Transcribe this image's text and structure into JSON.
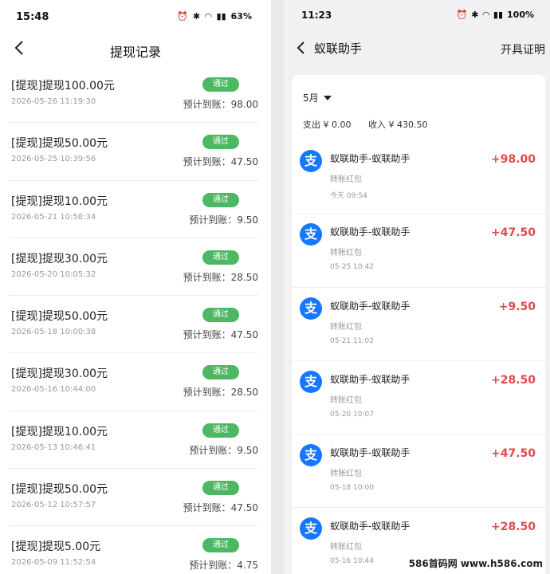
{
  "left": {
    "status": {
      "time": "15:48",
      "battery": "63%"
    },
    "nav": {
      "title": "提现记录"
    },
    "badge_label": "通过",
    "est_label": "预计到账：",
    "items": [
      {
        "title": "[提现]提现100.00元",
        "time": "2026-05-26 11:19:30",
        "est": "98.00"
      },
      {
        "title": "[提现]提现50.00元",
        "time": "2026-05-25 10:39:56",
        "est": "47.50"
      },
      {
        "title": "[提现]提现10.00元",
        "time": "2026-05-21 10:58:34",
        "est": "9.50"
      },
      {
        "title": "[提现]提现30.00元",
        "time": "2026-05-20 10:05:32",
        "est": "28.50"
      },
      {
        "title": "[提现]提现50.00元",
        "time": "2026-05-18 10:00:38",
        "est": "47.50"
      },
      {
        "title": "[提现]提现30.00元",
        "time": "2026-05-16 10:44:00",
        "est": "28.50"
      },
      {
        "title": "[提现]提现10.00元",
        "time": "2026-05-13 10:46:41",
        "est": "9.50"
      },
      {
        "title": "[提现]提现50.00元",
        "time": "2026-05-12 10:57:57",
        "est": "47.50"
      },
      {
        "title": "[提现]提现5.00元",
        "time": "2026-05-09 11:52:54",
        "est": "4.75"
      }
    ]
  },
  "right": {
    "status": {
      "time": "11:23",
      "battery": "100%"
    },
    "nav": {
      "title": "蚁联助手",
      "action": "开具证明"
    },
    "month": "5月",
    "summary": {
      "expense": "支出 ¥ 0.00",
      "income": "收入 ¥ 430.50"
    },
    "icon_glyph": "支",
    "items": [
      {
        "name": "蚁联助手-蚁联助手",
        "sub": "转账红包",
        "date": "今天 09:54",
        "amount": "+98.00"
      },
      {
        "name": "蚁联助手-蚁联助手",
        "sub": "转账红包",
        "date": "05-25 10:42",
        "amount": "+47.50"
      },
      {
        "name": "蚁联助手-蚁联助手",
        "sub": "转账红包",
        "date": "05-21 11:02",
        "amount": "+9.50"
      },
      {
        "name": "蚁联助手-蚁联助手",
        "sub": "转账红包",
        "date": "05-20 10:07",
        "amount": "+28.50"
      },
      {
        "name": "蚁联助手-蚁联助手",
        "sub": "转账红包",
        "date": "05-18 10:00",
        "amount": "+47.50"
      },
      {
        "name": "蚁联助手-蚁联助手",
        "sub": "转账红包",
        "date": "05-16 10:44",
        "amount": "+28.50"
      }
    ]
  },
  "watermark": "586首码网 www.h586.com"
}
